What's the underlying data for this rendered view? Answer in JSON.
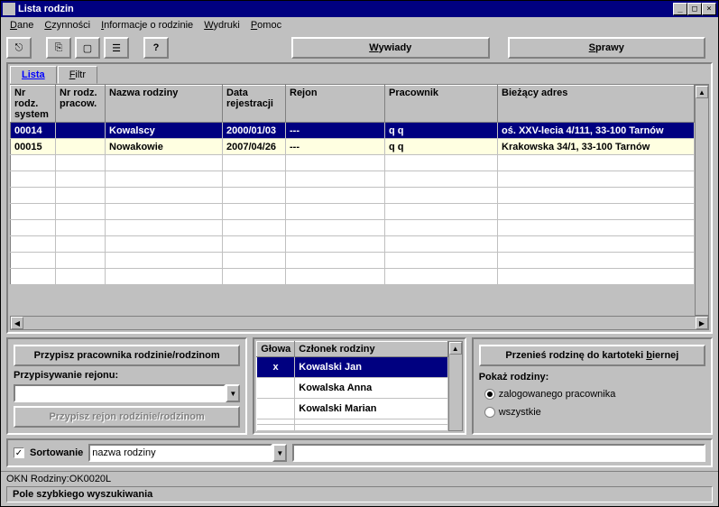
{
  "title": "Lista rodzin",
  "menu": [
    "Dane",
    "Czynności",
    "Informacje o rodzinie",
    "Wydruki",
    "Pomoc"
  ],
  "toolbar": {
    "wywiady": "Wywiady",
    "sprawy": "Sprawy"
  },
  "tabs": {
    "lista": "Lista",
    "filtr": "Filtr"
  },
  "columns": {
    "nr_system": "Nr rodz. system",
    "nr_pracow": "Nr rodz. pracow.",
    "nazwa": "Nazwa rodziny",
    "data": "Data rejestracji",
    "rejon": "Rejon",
    "pracownik": "Pracownik",
    "adres": "Bieżący adres"
  },
  "rows": [
    {
      "nr_system": "00014",
      "nr_pracow": "",
      "nazwa": "Kowalscy",
      "data": "2000/01/03",
      "rejon": "---",
      "pracownik": "q q",
      "adres": "oś. XXV-lecia 4/111, 33-100 Tarnów",
      "selected": true
    },
    {
      "nr_system": "00015",
      "nr_pracow": "",
      "nazwa": "Nowakowie",
      "data": "2007/04/26",
      "rejon": "---",
      "pracownik": "q q",
      "adres": "Krakowska 34/1, 33-100 Tarnów",
      "selected": false
    }
  ],
  "left": {
    "przypisz_prac": "Przypisz pracownika rodzinie/rodzinom",
    "przypisywanie_rejonu": "Przypisywanie rejonu:",
    "przypisz_rejon": "Przypisz rejon rodzinie/rodzinom"
  },
  "members": {
    "col_glowa": "Głowa",
    "col_czlonek": "Członek rodziny",
    "rows": [
      {
        "glowa": "x",
        "name": "Kowalski Jan",
        "selected": true
      },
      {
        "glowa": "",
        "name": "Kowalska Anna",
        "selected": false
      },
      {
        "glowa": "",
        "name": "Kowalski Marian",
        "selected": false
      }
    ]
  },
  "right": {
    "przenies": "Przenieś rodzinę do kartoteki biernej",
    "pokaz_label": "Pokaż rodziny:",
    "opt_zalog": "zalogowanego pracownika",
    "opt_wszystkie": "wszystkie"
  },
  "sort": {
    "label": "Sortowanie",
    "value": "nazwa rodziny",
    "checked": true
  },
  "status1": "OKN Rodziny:OK0020L",
  "status2": "Pole szybkiego wyszukiwania"
}
